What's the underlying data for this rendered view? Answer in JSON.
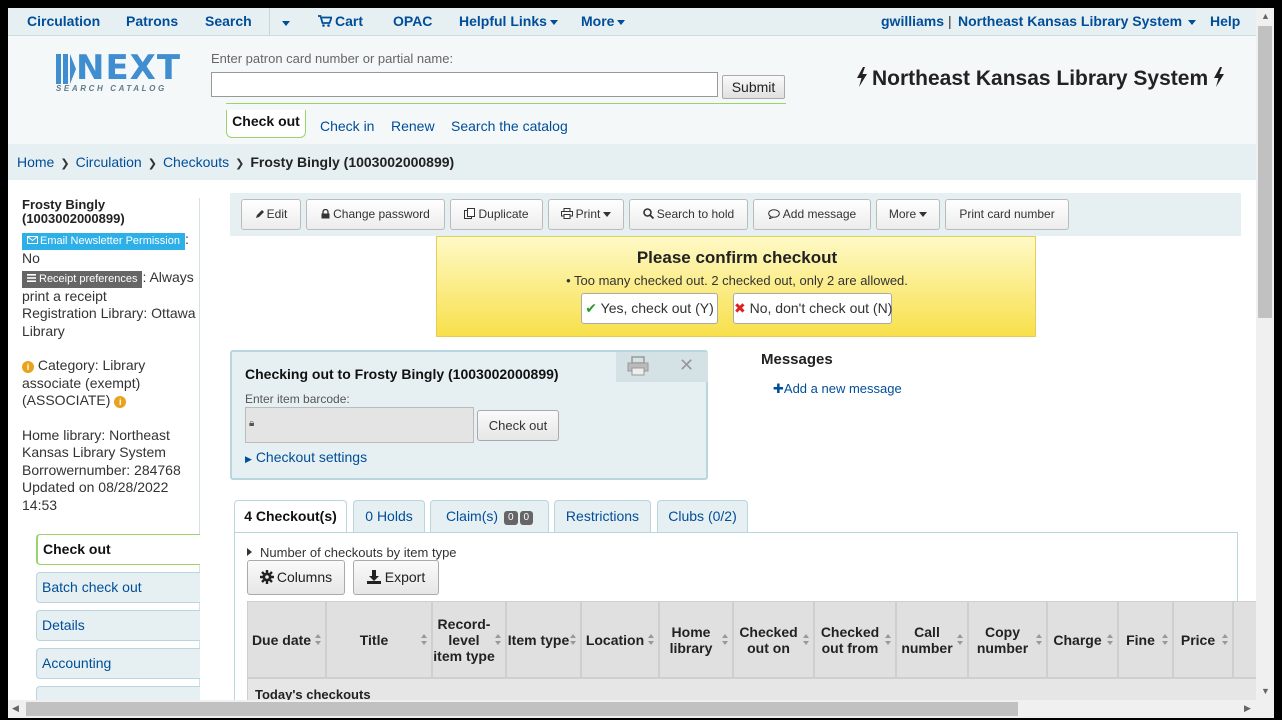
{
  "topnav": {
    "items": [
      "Circulation",
      "Patrons",
      "Search",
      "Cart",
      "OPAC",
      "Helpful Links",
      "More"
    ],
    "user": "gwilliams",
    "library": "Northeast Kansas Library System",
    "help": "Help"
  },
  "header": {
    "logo_word": "NEXT",
    "logo_sub": "SEARCH CATALOG",
    "patron_label": "Enter patron card number or partial name:",
    "submit": "Submit",
    "subtabs": [
      "Check out",
      "Check in",
      "Renew",
      "Search the catalog"
    ],
    "library_title": "Northeast Kansas Library System"
  },
  "breadcrumb": [
    "Home",
    "Circulation",
    "Checkouts",
    "Frosty Bingly (1003002000899)"
  ],
  "patron": {
    "name": "Frosty Bingly",
    "card": "(1003002000899)",
    "email_label": "Email Newsletter Permission",
    "email_value": ": No",
    "receipt_label": "Receipt preferences",
    "receipt_value": ": Always print a receipt",
    "registration": "Registration Library: Ottawa Library",
    "category": "Category: Library associate (exempt) (ASSOCIATE)",
    "home_library": "Home library: Northeast Kansas Library System",
    "borrowernumber": "Borrowernumber: 284768",
    "updated": "Updated on 08/28/2022 14:53"
  },
  "leftnav": [
    "Check out",
    "Batch check out",
    "Details",
    "Accounting"
  ],
  "toolbar": [
    "Edit",
    "Change password",
    "Duplicate",
    "Print",
    "Search to hold",
    "Add message",
    "More",
    "Print card number"
  ],
  "alert": {
    "title": "Please confirm checkout",
    "message": "Too many checked out. 2 checked out, only 2 are allowed.",
    "yes": "Yes, check out (Y)",
    "no": "No, don't check out (N)"
  },
  "panel": {
    "title": "Checking out to Frosty Bingly (1003002000899)",
    "barcode_label": "Enter item barcode:",
    "checkout": "Check out",
    "settings": "Checkout settings"
  },
  "messages": {
    "title": "Messages",
    "add": "Add a new message"
  },
  "tabs": [
    "4 Checkout(s)",
    "0 Holds",
    "Claim(s)",
    "Restrictions",
    "Clubs (0/2)"
  ],
  "claims_badges": [
    "0",
    "0"
  ],
  "checkouts": {
    "summary": "Number of checkouts by item type",
    "columns_btn": "Columns",
    "export_btn": "Export",
    "headers": [
      "Due date",
      "Title",
      "Record-level item type",
      "Item type",
      "Location",
      "Home library",
      "Checked out on",
      "Checked out from",
      "Call number",
      "Copy number",
      "Charge",
      "Fine",
      "Price"
    ],
    "group_label": "Today's checkouts"
  },
  "colors": {
    "link": "#004d99",
    "accent_green": "#9bd36b",
    "alert_yellow": "#f8e04b",
    "nav_bg": "#e6f0f2"
  }
}
